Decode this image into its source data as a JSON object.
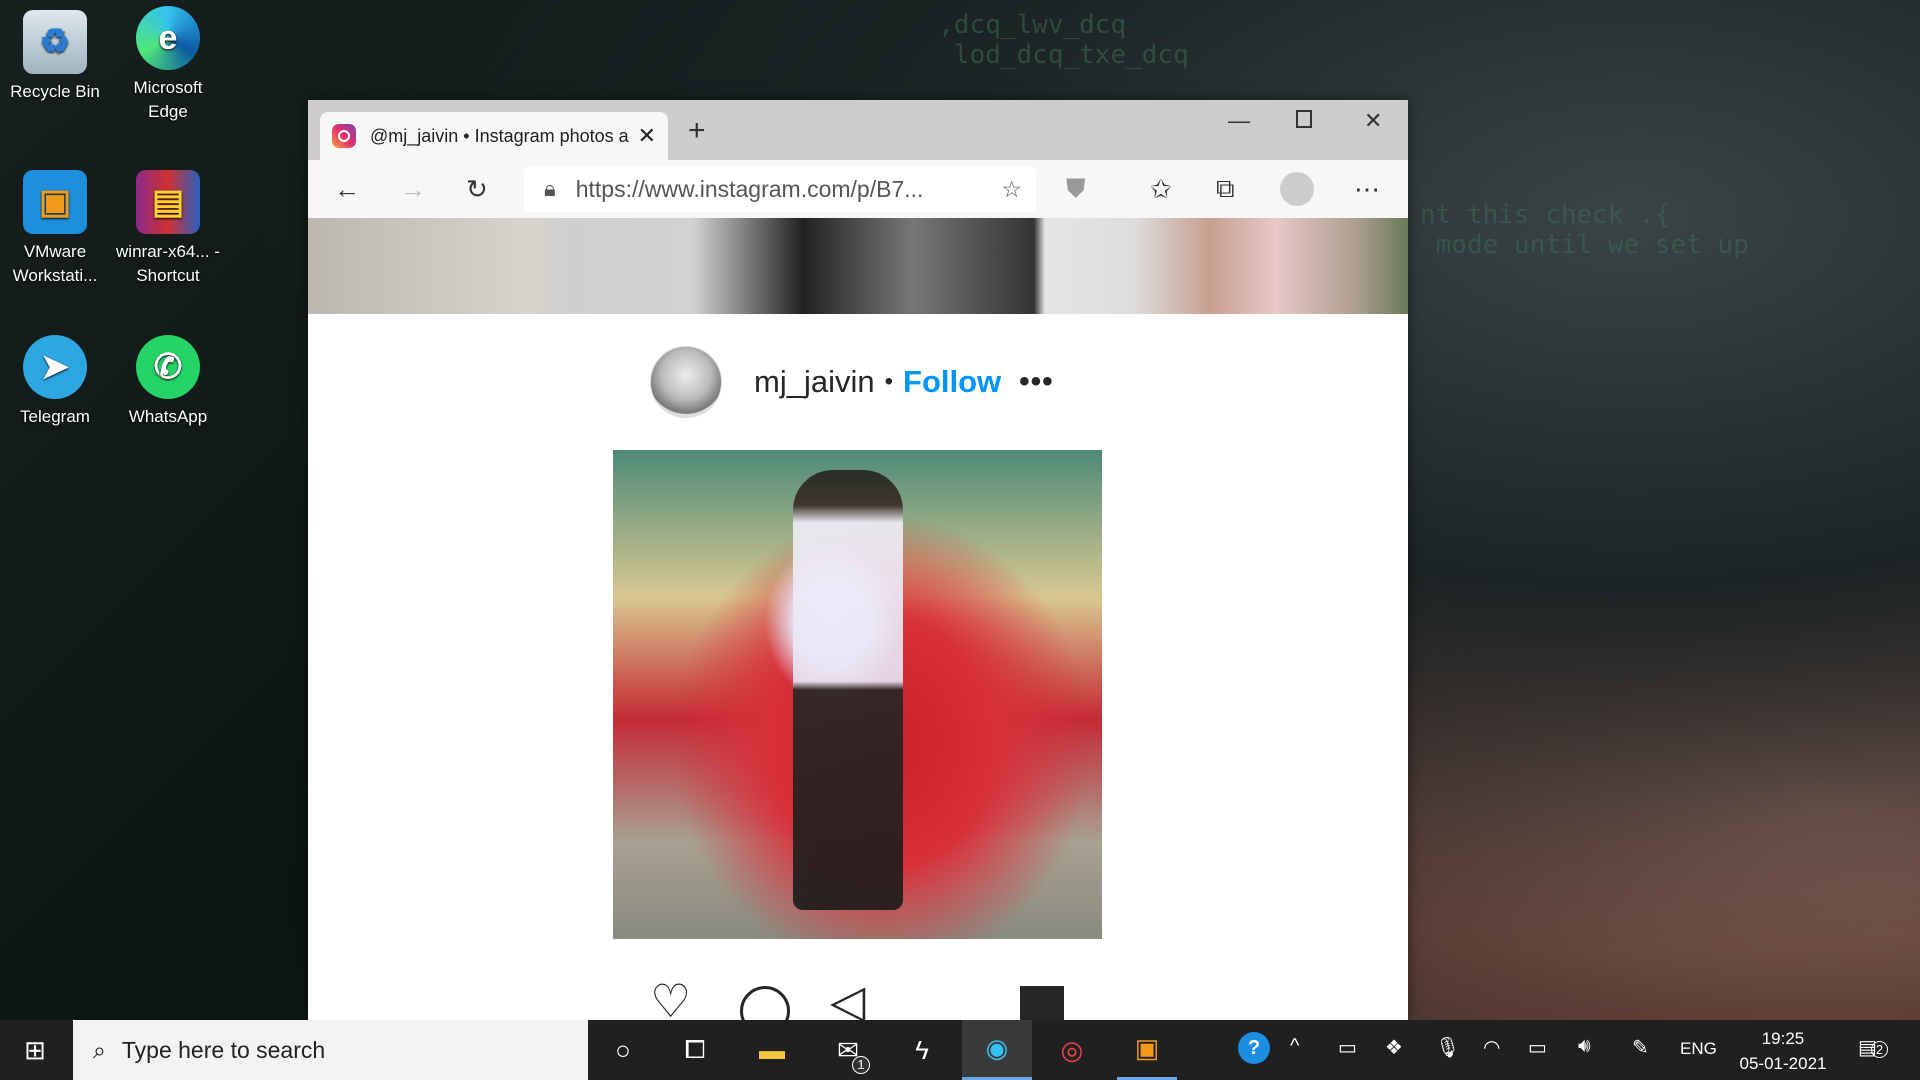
{
  "desktop": {
    "icons": [
      {
        "label": "Recycle Bin",
        "icon": "recycle-bin-icon"
      },
      {
        "label": "Microsoft Edge",
        "icon": "edge-icon"
      },
      {
        "label": "VMware Workstati...",
        "icon": "vmware-icon"
      },
      {
        "label": "winrar-x64... - Shortcut",
        "icon": "winrar-icon"
      },
      {
        "label": "Telegram",
        "icon": "telegram-icon"
      },
      {
        "label": "WhatsApp",
        "icon": "whatsapp-icon"
      }
    ]
  },
  "browser": {
    "tab_title": "@mj_jaivin • Instagram photos a",
    "url": "https://www.instagram.com/p/B7..."
  },
  "post": {
    "username": "mj_jaivin",
    "separator": "•",
    "follow_label": "Follow",
    "more": "•••"
  },
  "taskbar": {
    "search_placeholder": "Type here to search",
    "mail_badge": "1",
    "language": "ENG",
    "time": "19:25",
    "date": "05-01-2021",
    "notifications": "2"
  }
}
